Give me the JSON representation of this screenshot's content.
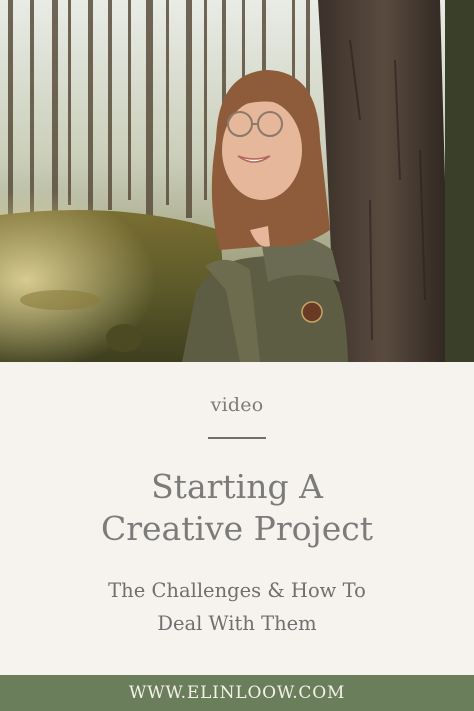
{
  "kicker": "video",
  "title": [
    "Starting A",
    "Creative Project"
  ],
  "subtitle": [
    "The Challenges & How To",
    "Deal With Them"
  ],
  "footer": "WWW.ELINLOOW.COM",
  "colors": {
    "panel_background": "#f6f3ee",
    "text": "#7b7b7b",
    "footer_background": "#6b7e5b",
    "footer_text": "#f3f1e8"
  }
}
